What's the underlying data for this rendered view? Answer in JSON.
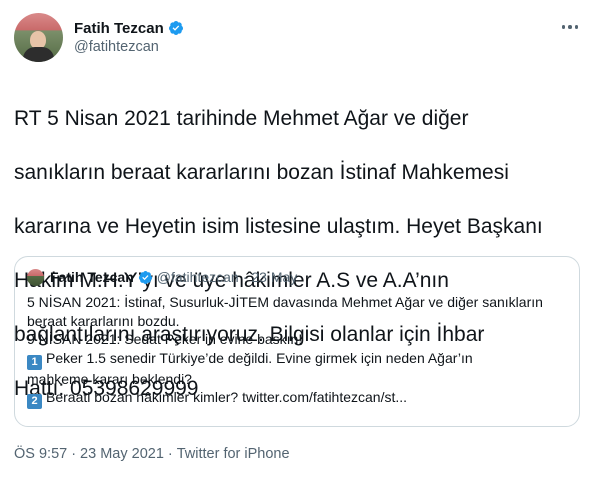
{
  "author": {
    "display_name": "Fatih Tezcan",
    "handle": "@fatihtezcan",
    "verified": true
  },
  "tweet": {
    "lines": [
      "RT 5 Nisan 2021 tarihinde Mehmet Ağar ve diğer",
      "sanıkların beraat kararlarını bozan İstinaf Mahkemesi",
      "kararına ve Heyetin isim listesine ulaştım. Heyet Başkanı",
      "Hâkim M.H.Y’yı ve üye hâkimler A.S ve A.A’nın",
      "bağlantılarını araştırıyoruz. Bilgisi olanlar için İhbar",
      "Hattı: 05398629999"
    ]
  },
  "quoted_tweet": {
    "display_name": "Fatih Tezcan",
    "handle": "@fatihtezcan",
    "separator": "·",
    "date": "23 May",
    "lines": [
      "5 NİSAN 2021: İstinaf, Susurluk-JİTEM davasında Mehmet Ağar ve diğer sanıkların",
      "beraat kararlarını bozdu.",
      "9 NİSAN 2021: Sedat Peker’in evine baskın!"
    ],
    "item1": {
      "badge": "1",
      "line1": "Peker 1.5 senedir Türkiye’de değildi. Evine girmek için neden Ağar’ın",
      "line2": "mahkeme kararı beklendi?"
    },
    "item2": {
      "badge": "2",
      "text": "Beraati bozan hâkimler kimler? twitter.com/fatihtezcan/st..."
    }
  },
  "meta": {
    "time": "ÖS 9:57",
    "separator": "·",
    "date": "23 May 2021",
    "source": "Twitter for iPhone"
  },
  "colors": {
    "verified": "#1d9bf0",
    "secondary_text": "#536471",
    "border": "#cfd9de",
    "keycap": "#3b88c3"
  },
  "icons": {
    "verified": "verified-badge-icon",
    "more": "more-dots-icon"
  }
}
